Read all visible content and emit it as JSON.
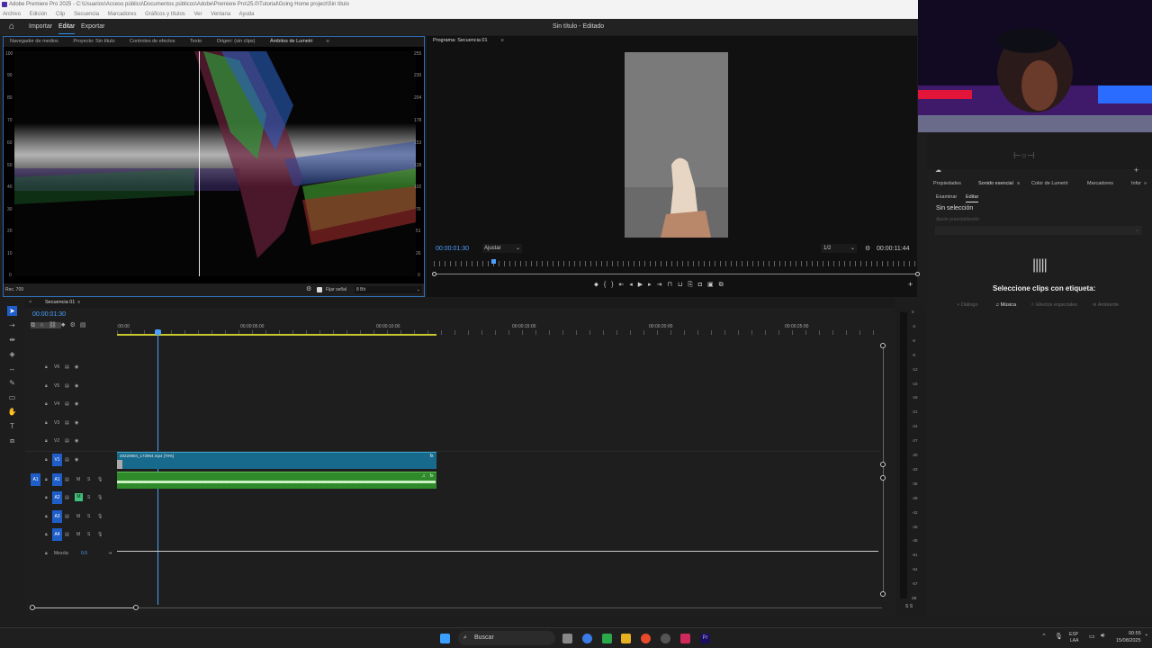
{
  "window": {
    "title": "Adobe Premiere Pro 2025 - C:\\Usuarios\\Acceso público\\Documentos públicos\\Adobe\\Premiere Pro\\25.0\\Tutorial\\Going Home project\\Sin título",
    "menu": [
      "Archivo",
      "Edición",
      "Clip",
      "Secuencia",
      "Marcadores",
      "Gráficos y títulos",
      "Ver",
      "Ventana",
      "Ayuda"
    ]
  },
  "header": {
    "modes": [
      "Importar",
      "Editar",
      "Exportar"
    ],
    "active_mode": "Editar",
    "doc_title": "Sin título - Editado"
  },
  "source_panel": {
    "tabs": [
      "Navegador de medios",
      "Proyecto: Sin título",
      "Controles de efectos",
      "Texto",
      "Origen: (sin clips)",
      "Ámbitos de Lumetri"
    ],
    "active_tab": "Ámbitos de Lumetri",
    "y_left": [
      "100",
      "90",
      "80",
      "70",
      "60",
      "50",
      "40",
      "30",
      "20",
      "10",
      "0"
    ],
    "y_right": [
      "255",
      "230",
      "204",
      "178",
      "153",
      "128",
      "102",
      "76",
      "51",
      "26",
      "0"
    ],
    "colorspace": "Rec. 709",
    "clamp_label": "Fijar señal",
    "bit_depth": "8 Bit"
  },
  "program_panel": {
    "title": "Programa: Secuencia 01",
    "timecode": "00:00:01:30",
    "fit": "Ajustar",
    "resolution": "1/2",
    "duration": "00:00:11:44"
  },
  "timeline": {
    "tab": "Secuencia 01",
    "timecode": "00:00:01:30",
    "ruler": [
      ":00:00",
      "00:00:05:00",
      "00:00:10:00",
      "00:00:15:00",
      "00:00:20:00",
      "00:00:25:00"
    ],
    "video_tracks": [
      "V6",
      "V5",
      "V4",
      "V3",
      "V2",
      "V1"
    ],
    "audio_tracks": [
      "A1",
      "A2",
      "A3",
      "A4"
    ],
    "mix_label": "Mezcla",
    "mix_value": "0.0",
    "clip_name": "20220904_172904.mp4 [70%]",
    "playhead_seconds": 1.5,
    "clip_end_seconds": 11.7
  },
  "meter": {
    "scale": [
      "0",
      "-3",
      "-6",
      "-9",
      "-12",
      "-15",
      "-18",
      "-21",
      "-24",
      "-27",
      "-30",
      "-33",
      "-36",
      "-39",
      "-42",
      "-45",
      "-48",
      "-51",
      "-54",
      "-57",
      "dB"
    ],
    "footer": "S  S"
  },
  "essential_sound": {
    "tabs": [
      "Propiedades",
      "Sonido esencial",
      "Color de Lumetri",
      "Marcadores",
      "Infor"
    ],
    "active_tab": "Sonido esencial",
    "subtabs": [
      "Examinar",
      "Editar"
    ],
    "active_subtab": "Editar",
    "no_selection": "Sin selección",
    "preset_label": "Ajuste preestablecido:",
    "prompt": "Seleccione clips con etiqueta:",
    "types": [
      "Diálogo",
      "Música",
      "Efectos especiales",
      "Ambiente"
    ],
    "active_type": "Música"
  },
  "taskbar": {
    "search": "Buscar",
    "lang": "ESP",
    "lang2": "LAA",
    "time": "00:55",
    "date": "15/08/2025"
  }
}
